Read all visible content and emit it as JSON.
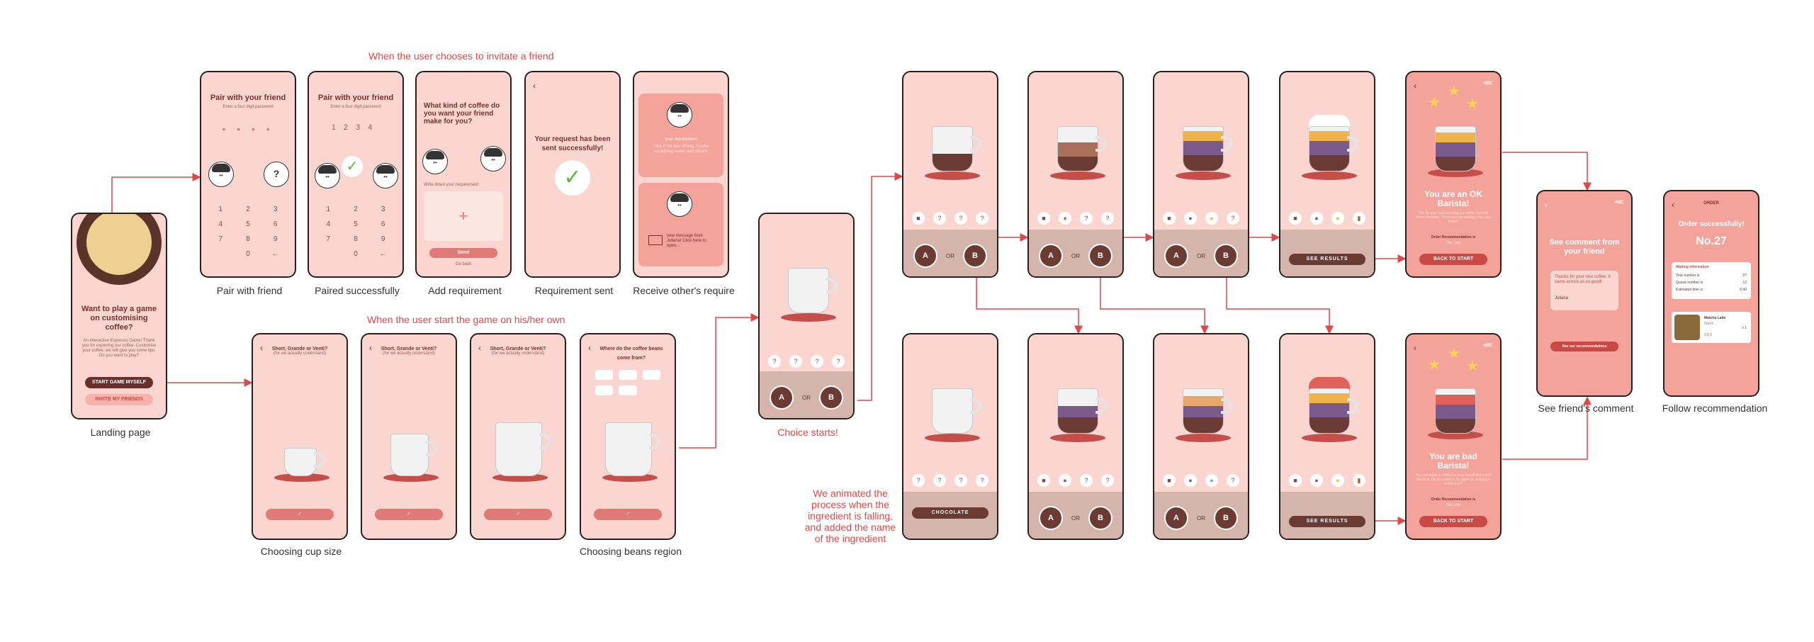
{
  "notes": {
    "invite": "When the user chooses to invitate a friend",
    "own": "When the user start the game on his/her own",
    "animated": "We animated the process when the ingredient is falling, and added the name of the ingredient"
  },
  "captions": {
    "landing": "Landing page",
    "pair": "Pair with friend",
    "paired": "Paired successfully",
    "addreq": "Add requirement",
    "sent": "Requirement sent",
    "receive": "Receive other's require",
    "cupsize": "Choosing cup size",
    "beans": "Choosing beans region",
    "choice": "Choice starts!",
    "comment": "See friend's comment",
    "follow": "Follow recommendation"
  },
  "landing": {
    "title": "Want to play a game on customising coffee?",
    "body": "An interactive Espresso Game! Thank you for exploring our coffee. Customise your coffee, we will give you some tips. Do you want to play?",
    "start": "START GAME MYSELF",
    "invite": "INVITE MY FRIENDS"
  },
  "pair": {
    "title": "Pair with your friend",
    "sub": "Enter a four digit password",
    "dots": "• • • •",
    "q": "?"
  },
  "paired": {
    "title": "Pair with your friend",
    "sub": "Enter a four digit password",
    "digits": "1234"
  },
  "keypad": [
    "1",
    "2",
    "3",
    "4",
    "5",
    "6",
    "7",
    "8",
    "9",
    "",
    "0",
    "←"
  ],
  "addreq": {
    "title": "What kind of coffee do you want your friend make for you?",
    "label": "Write down your requirement",
    "plus": "+",
    "send": "Send",
    "back": "Go back"
  },
  "sent": {
    "title": "Your request has been sent successfully!",
    "check": "✓"
  },
  "receive": {
    "req_label": "your requirement",
    "req_text": "I like it hot and strong, maybe something sweet and vibrant.",
    "msg": "new message from Juliana! Click here to open..."
  },
  "cupsize": {
    "title": "Short, Grande or Venti?",
    "sub": "(for we actually understand)"
  },
  "beans": {
    "title": "Where do the coffee beans come from?"
  },
  "choice": {
    "q": "?",
    "a": "A",
    "b": "B",
    "or": "OR"
  },
  "steps": {
    "a": "A",
    "b": "B",
    "or": "OR",
    "see": "SEE RESULTS",
    "ingredient": "CHOCOLATE",
    "q": "?"
  },
  "ok_result": {
    "title": "You are an OK Barista!",
    "text": "You do your best creating the coffee but with some mistakes. Thank you for making it for your friend!",
    "rec_label": "Order Recommendation is",
    "rec": "Flat Latte",
    "btn": "BACK TO START"
  },
  "bad_result": {
    "title": "You are bad Barista!",
    "text": "You just made a coffee for your friend! But it isn't the best. Do you want to try again on making a better one?",
    "rec_label": "Order Recommendation is",
    "rec": "Flat Latte",
    "btn": "BACK TO START"
  },
  "comment": {
    "title": "See comment from your friend",
    "msg": "Thanks for your nice coffee. It came across as so good!",
    "sign": "Juliana",
    "btn": "See our recommendations"
  },
  "order": {
    "header": "ORDER",
    "title": "Order successfully!",
    "number": "No.27",
    "waiting": "Waiting information",
    "rows": [
      {
        "k": "Your number is",
        "v": "27"
      },
      {
        "k": "Queue number is",
        "v": "13"
      },
      {
        "k": "Estimated time is",
        "v": "6:40"
      }
    ],
    "item": "Matcha Latte",
    "item_sub": "Warm",
    "qty": "x 1",
    "price": "3,6 €"
  },
  "colors": {
    "phone": "#fbd6d1",
    "deep": "#f4a39a",
    "accent": "#d94a4a",
    "dark": "#6a3a33",
    "arrow": "#d94a4a"
  }
}
